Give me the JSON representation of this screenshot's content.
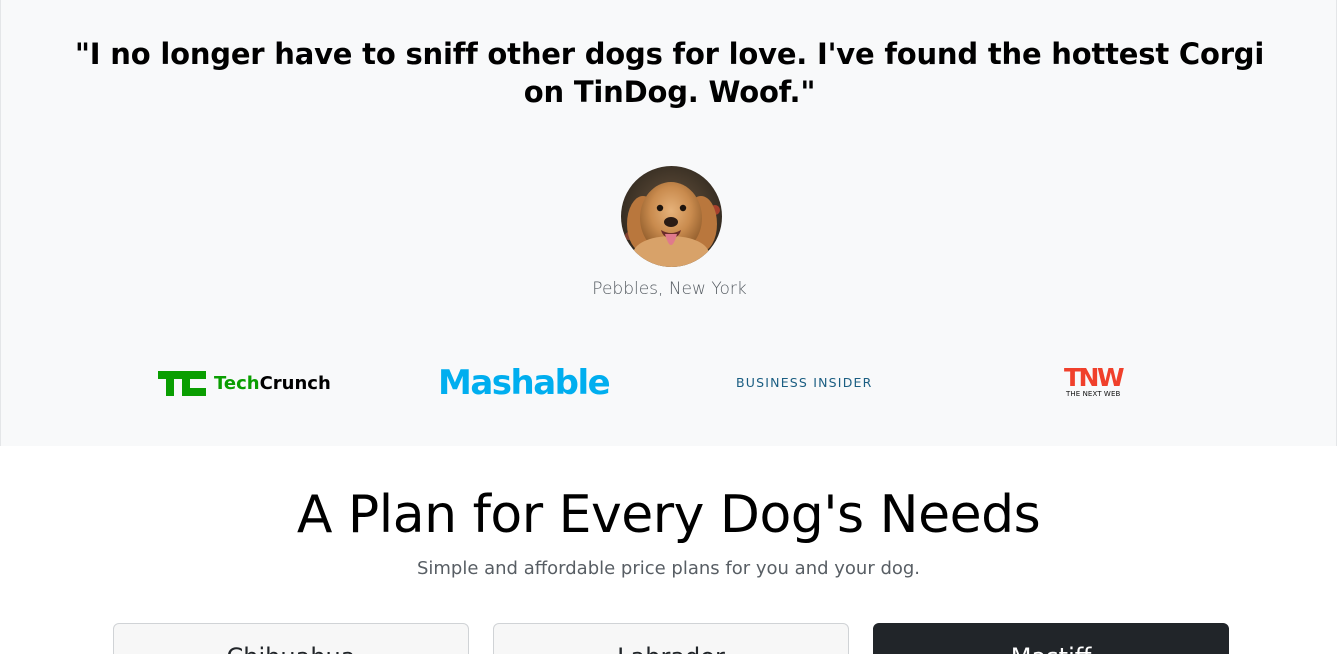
{
  "testimonial": {
    "quote": "\"I no longer have to sniff other dogs for love. I've found the hottest Corgi on TinDog. Woof.\"",
    "attribution": "Pebbles, New York"
  },
  "press": {
    "techcrunch_tech": "Tech",
    "techcrunch_crunch": "Crunch",
    "mashable": "Mashable",
    "business_insider": "BUSINESS INSIDER",
    "tnw_mark": "TNW",
    "tnw_subtitle": "THE NEXT WEB"
  },
  "pricing": {
    "title": "A Plan for Every Dog's Needs",
    "subtitle": "Simple and affordable price plans for you and your dog.",
    "plans": [
      {
        "name": "Chihuahua"
      },
      {
        "name": "Labrador"
      },
      {
        "name": "Mastiff"
      }
    ]
  },
  "colors": {
    "section_background": "#f8f9fa",
    "techcrunch_green": "#0a9e01",
    "mashable_blue": "#00aeef",
    "business_insider_blue": "#1b5e82",
    "tnw_red": "#f0402b",
    "dark_card": "#212529"
  },
  "icons": {
    "avatar": "golden-retriever-photo",
    "techcrunch": "techcrunch-logo",
    "tnw": "tnw-logo"
  }
}
